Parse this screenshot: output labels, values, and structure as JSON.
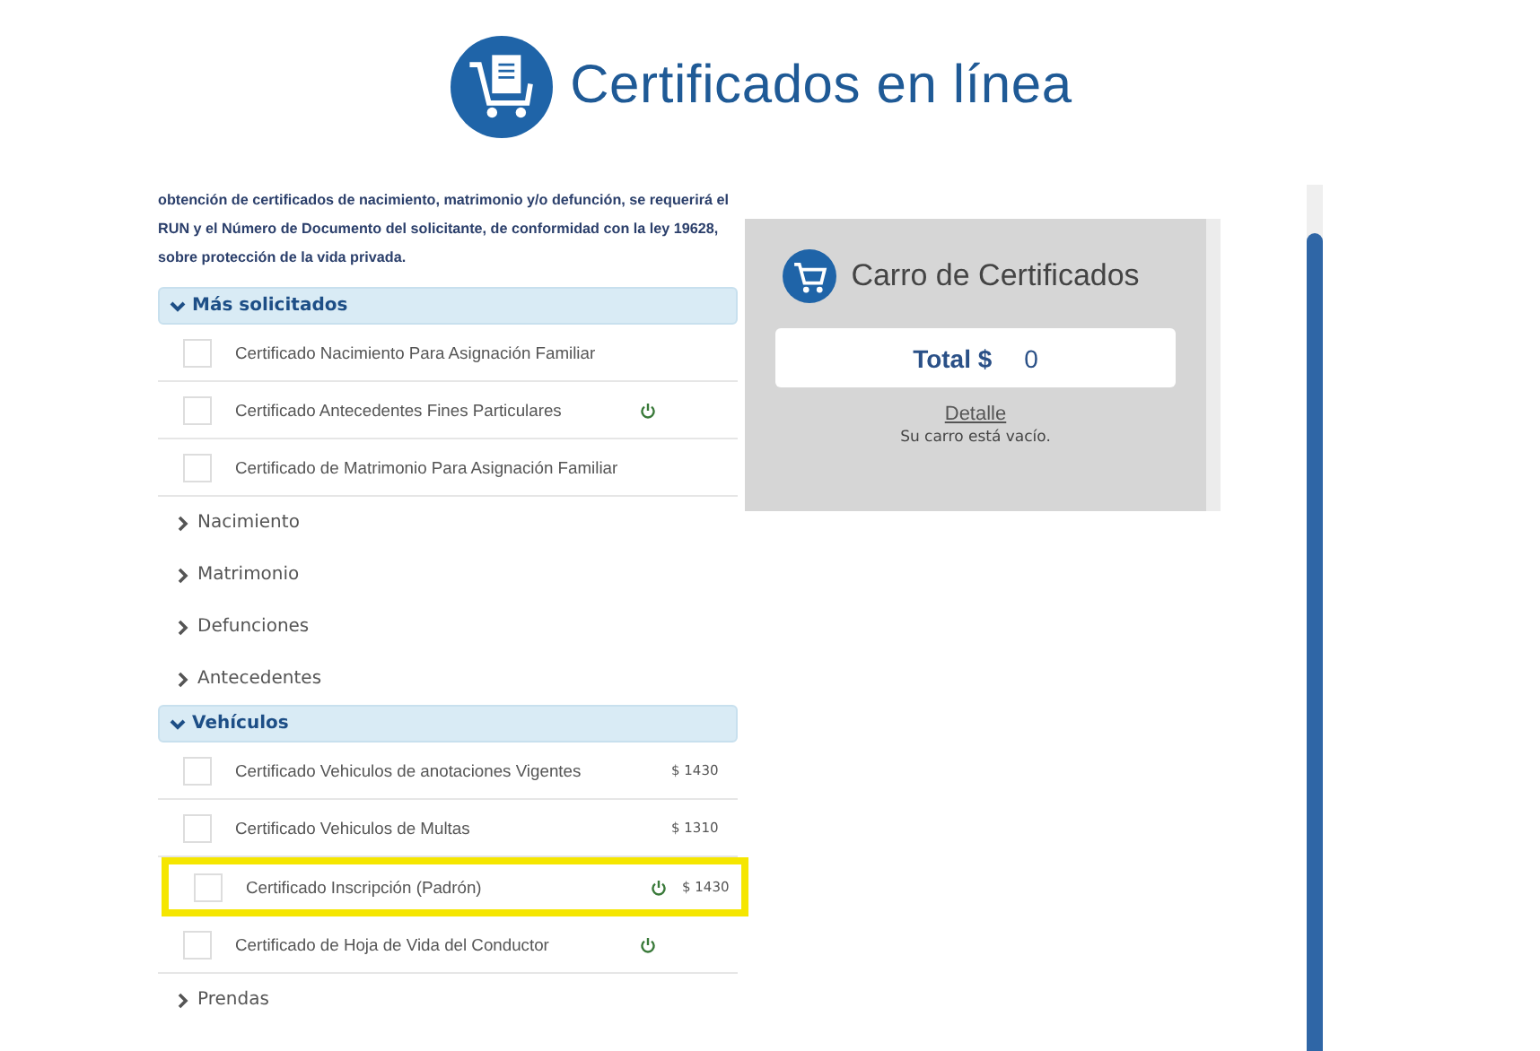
{
  "header": {
    "title": "Certificados en línea"
  },
  "intro": "obtención de certificados de nacimiento, matrimonio y/o defunción, se requerirá el RUN y el Número de Documento del solicitante, de conformidad con la ley 19628, sobre protección de la vida privada.",
  "sections": [
    {
      "label": "Más solicitados",
      "expanded": true,
      "items": [
        {
          "label": "Certificado Nacimiento Para Asignación Familiar",
          "checked": false,
          "power": false,
          "highlighted": false
        },
        {
          "label": "Certificado Antecedentes Fines Particulares",
          "checked": false,
          "power": true,
          "highlighted": false
        },
        {
          "label": "Certificado de Matrimonio Para Asignación Familiar",
          "checked": false,
          "power": false,
          "highlighted": false
        }
      ]
    },
    {
      "label": "Nacimiento",
      "expanded": false
    },
    {
      "label": "Matrimonio",
      "expanded": false
    },
    {
      "label": "Defunciones",
      "expanded": false
    },
    {
      "label": "Antecedentes",
      "expanded": false
    },
    {
      "label": "Vehículos",
      "expanded": true,
      "items": [
        {
          "label": "Certificado Vehiculos de anotaciones Vigentes",
          "checked": false,
          "power": false,
          "price": "$ 1430",
          "highlighted": false
        },
        {
          "label": "Certificado Vehiculos de Multas",
          "checked": false,
          "power": false,
          "price": "$ 1310",
          "highlighted": false
        },
        {
          "label": "Certificado Inscripción (Padrón)",
          "checked": false,
          "power": true,
          "price": "$ 1430",
          "highlighted": true
        },
        {
          "label": "Certificado de Hoja de Vida del Conductor",
          "checked": false,
          "power": true,
          "highlighted": false
        }
      ]
    },
    {
      "label": "Prendas",
      "expanded": false
    }
  ],
  "cart": {
    "title": "Carro de Certificados",
    "total_label": "Total $",
    "total": "0",
    "detail_link": "Detalle",
    "message": "Su carro está vacío."
  }
}
